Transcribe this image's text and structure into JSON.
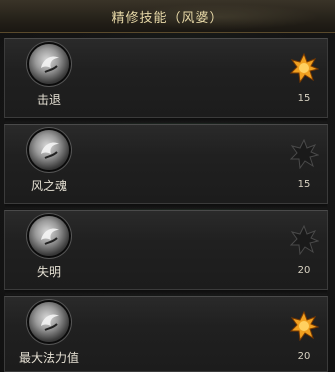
{
  "window": {
    "title": "精修技能（风婆）"
  },
  "skills": [
    {
      "name": "击退",
      "level": "15",
      "star_state": "lit",
      "star_icon": "orange-star-icon"
    },
    {
      "name": "风之魂",
      "level": "15",
      "star_state": "dark",
      "star_icon": "dark-star-icon"
    },
    {
      "name": "失明",
      "level": "20",
      "star_state": "dark",
      "star_icon": "dark-star-icon"
    },
    {
      "name": "最大法力值",
      "level": "20",
      "star_state": "lit",
      "star_icon": "orange-star-icon"
    }
  ],
  "colors": {
    "title_text": "#e8d9a8",
    "star_lit": "#f0a020",
    "star_dark": "#1a1a1a"
  }
}
